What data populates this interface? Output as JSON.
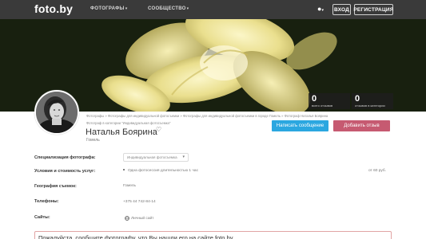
{
  "header": {
    "logo": "foto.by",
    "nav": [
      {
        "label": "ФОТОГРАФЫ"
      },
      {
        "label": "СООБЩЕСТВО"
      }
    ],
    "login_label": "ВХОД",
    "register_label": "РЕГИСТРАЦИЯ"
  },
  "stats": [
    {
      "value": "0",
      "label": "всего отзывов"
    },
    {
      "value": "0",
      "label": "отзывов в категории"
    }
  ],
  "profile": {
    "breadcrumb": "Фотографы » Фотографы для индивидуальной фотосъемки » Фотографы для индивидуальной фотосъемки в городе Гомель » Фотограф Наталья Боярина",
    "breadcrumb_sub": "Фотограф в категории \"Индивидуальная фотосъемка\"",
    "name": "Наталья Боярина",
    "city": "Гомель",
    "message_button": "Написать сообщение",
    "review_button": "Добавить отзыв"
  },
  "details": {
    "specialization_label": "Специализация фотографа:",
    "specialization_value": "Индивидуальная фотосъемка",
    "conditions_label": "Условия и стоимость услуг:",
    "conditions_value": "Одна фотосессия длительностью 1 час",
    "conditions_price": "от 60 руб.",
    "geography_label": "География съемок:",
    "geography_value": "Гомель",
    "phones_label": "Телефоны:",
    "phones_value": "+375 44 742-84-14",
    "sites_label": "Сайты:",
    "sites_value": "Личный сайт"
  },
  "notice": "Пожалуйста, сообщите фотографу, что Вы нашли его на сайте foto.by",
  "colors": {
    "topbar": "#3a3a3a",
    "message_button": "#2ba7e0",
    "review_button": "#c65a71",
    "notice_border": "#e1a4a4"
  },
  "icons": [
    "chevron-down-icon",
    "globe-icon",
    "heart-icon",
    "web-icon"
  ]
}
